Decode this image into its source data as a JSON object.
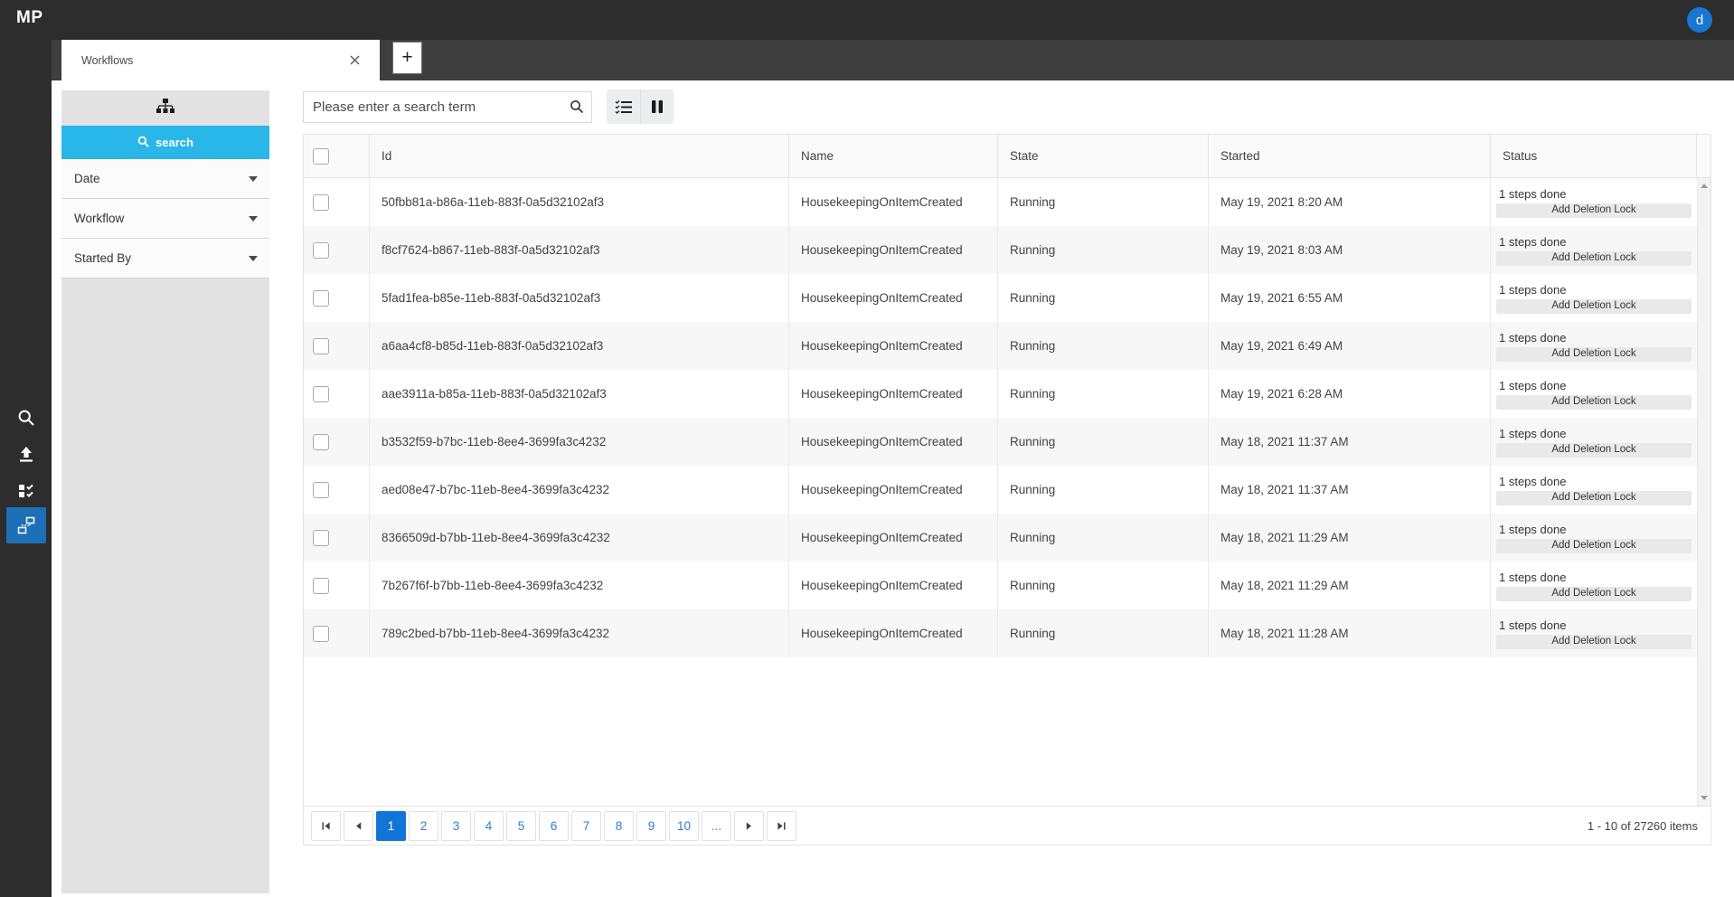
{
  "app": {
    "logo": "MP",
    "avatar_initial": "d"
  },
  "tab_bar": {
    "active_tab": "Workflows",
    "new_tab_button": "+"
  },
  "filter_panel": {
    "search_button_label": "search",
    "sections": [
      {
        "label": "Date"
      },
      {
        "label": "Workflow"
      },
      {
        "label": "Started By"
      }
    ]
  },
  "toolbar": {
    "search_placeholder": "Please enter a search term"
  },
  "grid": {
    "columns": {
      "id": "Id",
      "name": "Name",
      "state": "State",
      "started": "Started",
      "status": "Status"
    },
    "rows": [
      {
        "id": "50fbb81a-b86a-11eb-883f-0a5d32102af3",
        "name": "HousekeepingOnItemCreated",
        "state": "Running",
        "started": "May 19, 2021 8:20 AM",
        "steps": "1 steps done",
        "action": "Add Deletion Lock"
      },
      {
        "id": "f8cf7624-b867-11eb-883f-0a5d32102af3",
        "name": "HousekeepingOnItemCreated",
        "state": "Running",
        "started": "May 19, 2021 8:03 AM",
        "steps": "1 steps done",
        "action": "Add Deletion Lock"
      },
      {
        "id": "5fad1fea-b85e-11eb-883f-0a5d32102af3",
        "name": "HousekeepingOnItemCreated",
        "state": "Running",
        "started": "May 19, 2021 6:55 AM",
        "steps": "1 steps done",
        "action": "Add Deletion Lock"
      },
      {
        "id": "a6aa4cf8-b85d-11eb-883f-0a5d32102af3",
        "name": "HousekeepingOnItemCreated",
        "state": "Running",
        "started": "May 19, 2021 6:49 AM",
        "steps": "1 steps done",
        "action": "Add Deletion Lock"
      },
      {
        "id": "aae3911a-b85a-11eb-883f-0a5d32102af3",
        "name": "HousekeepingOnItemCreated",
        "state": "Running",
        "started": "May 19, 2021 6:28 AM",
        "steps": "1 steps done",
        "action": "Add Deletion Lock"
      },
      {
        "id": "b3532f59-b7bc-11eb-8ee4-3699fa3c4232",
        "name": "HousekeepingOnItemCreated",
        "state": "Running",
        "started": "May 18, 2021 11:37 AM",
        "steps": "1 steps done",
        "action": "Add Deletion Lock"
      },
      {
        "id": "aed08e47-b7bc-11eb-8ee4-3699fa3c4232",
        "name": "HousekeepingOnItemCreated",
        "state": "Running",
        "started": "May 18, 2021 11:37 AM",
        "steps": "1 steps done",
        "action": "Add Deletion Lock"
      },
      {
        "id": "8366509d-b7bb-11eb-8ee4-3699fa3c4232",
        "name": "HousekeepingOnItemCreated",
        "state": "Running",
        "started": "May 18, 2021 11:29 AM",
        "steps": "1 steps done",
        "action": "Add Deletion Lock"
      },
      {
        "id": "7b267f6f-b7bb-11eb-8ee4-3699fa3c4232",
        "name": "HousekeepingOnItemCreated",
        "state": "Running",
        "started": "May 18, 2021 11:29 AM",
        "steps": "1 steps done",
        "action": "Add Deletion Lock"
      },
      {
        "id": "789c2bed-b7bb-11eb-8ee4-3699fa3c4232",
        "name": "HousekeepingOnItemCreated",
        "state": "Running",
        "started": "May 18, 2021 11:28 AM",
        "steps": "1 steps done",
        "action": "Add Deletion Lock"
      }
    ]
  },
  "pager": {
    "pages": [
      "1",
      "2",
      "3",
      "4",
      "5",
      "6",
      "7",
      "8",
      "9",
      "10",
      "..."
    ],
    "active_page": "1",
    "summary": "1 - 10 of 27260 items"
  },
  "icons": {
    "rail": [
      "search-icon",
      "upload-icon",
      "tasks-icon",
      "workflow-icon"
    ],
    "panel_header": "sitemap-icon",
    "search_input": "magnifier-icon",
    "toolbar": [
      "checklist-icon",
      "pause-icon"
    ],
    "tab": "close-icon",
    "pager": [
      "first-page-icon",
      "prev-page-icon",
      "next-page-icon",
      "last-page-icon"
    ],
    "scrollbar": [
      "arrow-up-icon",
      "arrow-down-icon"
    ]
  },
  "colors": {
    "chrome_dark": "#2d2d2d",
    "tab_bar": "#3e3e3e",
    "active_nav_blue": "#1d70b8",
    "avatar_blue": "#1976d2",
    "search_button_cyan": "#29b6e8",
    "pager_active_blue": "#1374d8",
    "link_blue": "#2e7dd1"
  }
}
